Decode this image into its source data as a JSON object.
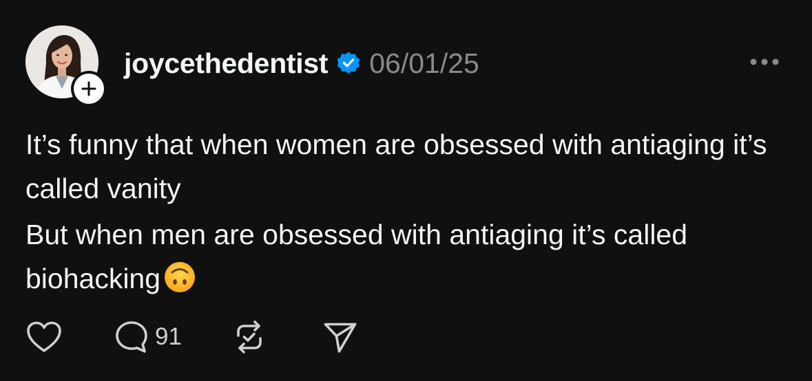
{
  "post": {
    "username": "joycethedentist",
    "verified": true,
    "timestamp": "06/01/25",
    "paragraphs": [
      "It’s funny that when women are obsessed with antiaging it’s called vanity",
      "But when men are obsessed with antiaging it’s called biohacking"
    ],
    "emoji": "upside-down-face",
    "counts": {
      "replies": "91"
    }
  },
  "icons": {
    "avatar": "profile-photo",
    "follow": "plus-icon",
    "verified": "verified-badge-icon",
    "more": "more-horizontal-icon",
    "like": "heart-icon",
    "reply": "comment-icon",
    "repost": "repost-icon",
    "share": "send-icon"
  },
  "colors": {
    "background": "#101010",
    "text": "#f3f5f7",
    "muted": "#8a8a8a",
    "verified": "#0095f6"
  }
}
